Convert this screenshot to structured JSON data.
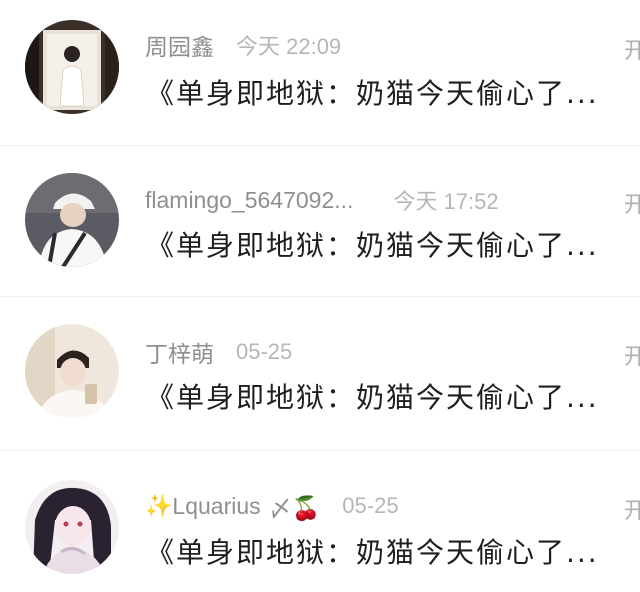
{
  "messages": [
    {
      "name": "周园鑫",
      "time": "今天 22:09",
      "preview": "《单身即地狱：奶猫今天偷心了...",
      "action": "开"
    },
    {
      "name": "flamingo_5647092...",
      "time": "今天 17:52",
      "preview": "《单身即地狱：奶猫今天偷心了...",
      "action": "开"
    },
    {
      "name": "丁梓萌",
      "time": "05-25",
      "preview": "《单身即地狱：奶猫今天偷心了...",
      "action": "开"
    },
    {
      "name_prefix": "✨",
      "name": "Lquarius",
      "name_suffix": "〆🍒",
      "time": "05-25",
      "preview": "《单身即地狱：奶猫今天偷心了...",
      "action": "开"
    }
  ],
  "colors": {
    "name": "#8f8f8f",
    "time": "#b6b6b6",
    "preview": "#1f1f1f",
    "divider": "#f0f0f0"
  },
  "icons": [
    "avatar-photo",
    "sparkle-emoji",
    "cherry-emoji"
  ]
}
